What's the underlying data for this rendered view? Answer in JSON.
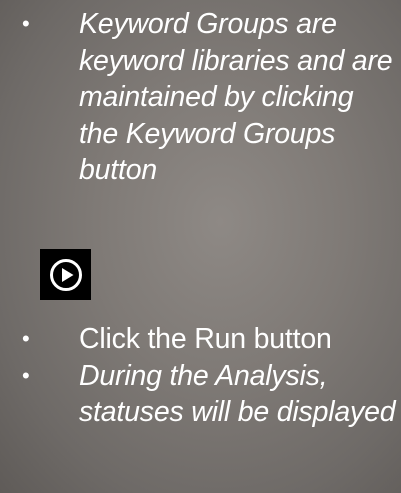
{
  "slide": {
    "top_bullets": [
      {
        "marker": "•",
        "text": "Keyword Groups are keyword libraries and are maintained by clicking the Keyword Groups button",
        "italic": true
      }
    ],
    "run_button_icon": "play-circle-icon",
    "bottom_bullets": [
      {
        "marker": "•",
        "text": "Click the Run button",
        "italic": false
      },
      {
        "marker": "•",
        "text": "During the Analysis, statuses will be displayed",
        "italic": true
      }
    ]
  },
  "colors": {
    "background": "#807b77",
    "text": "#ffffff",
    "icon_box": "#000000"
  }
}
